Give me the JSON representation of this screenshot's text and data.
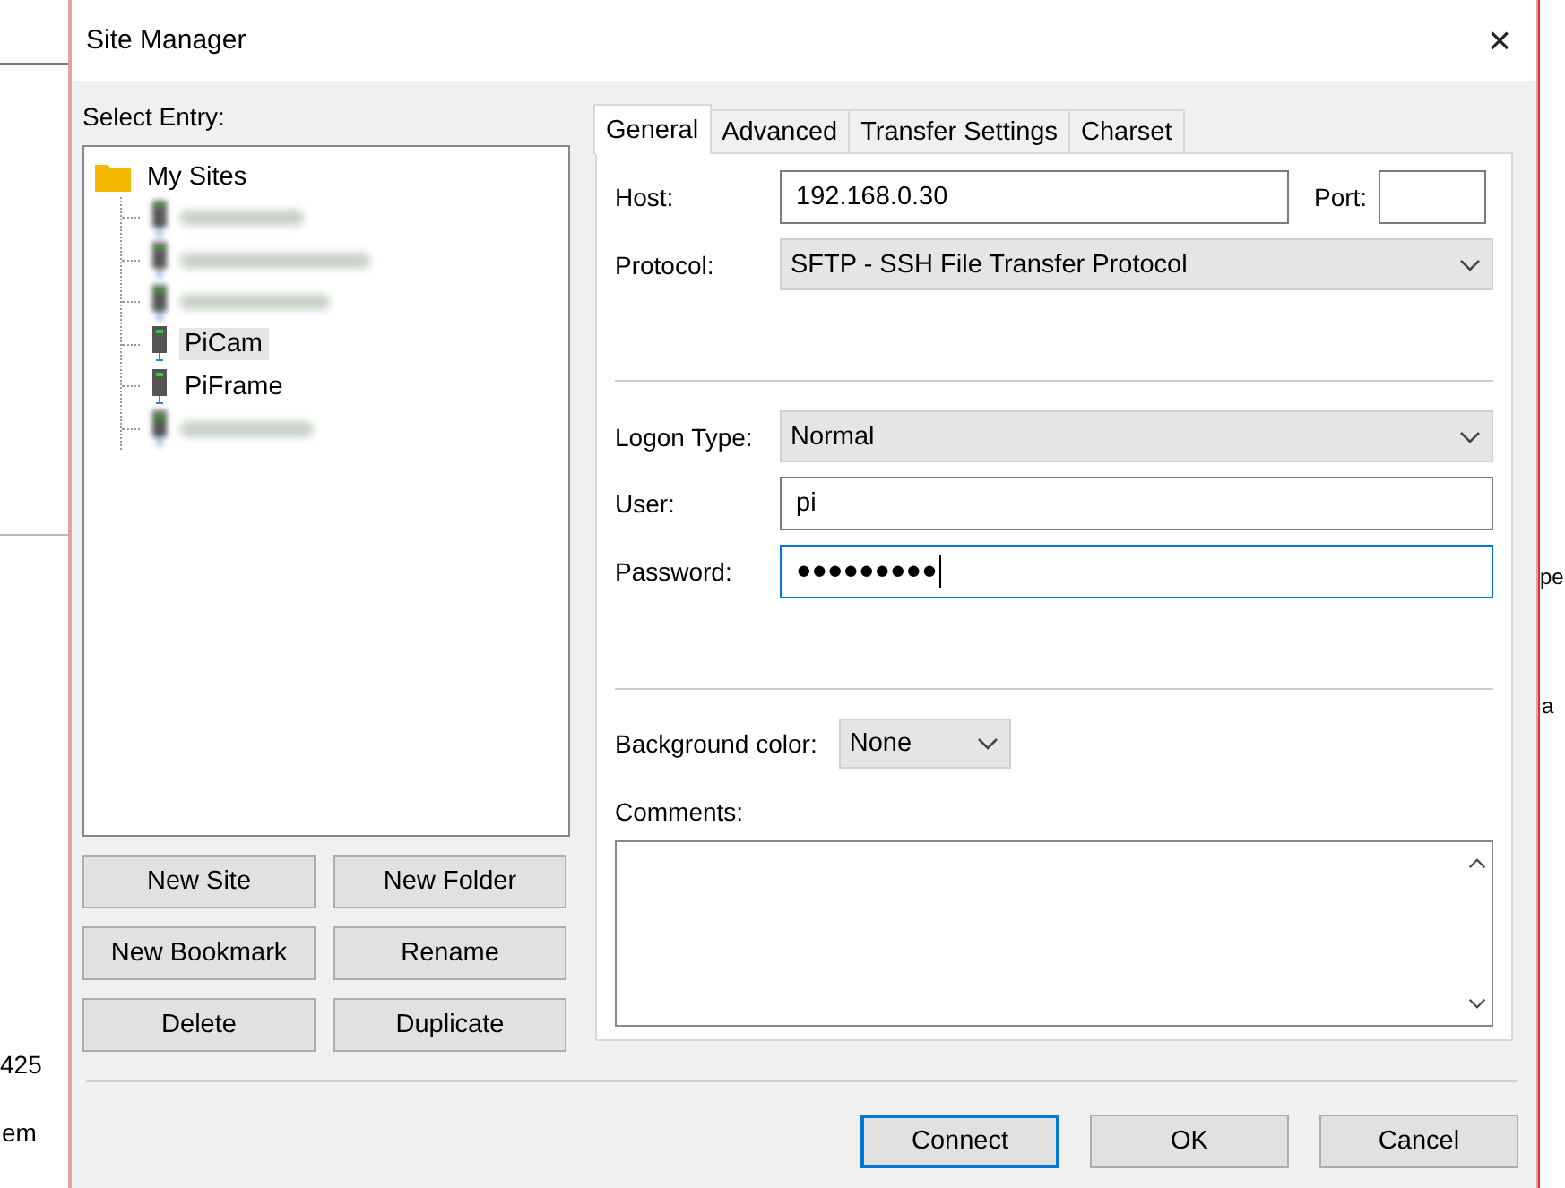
{
  "background_window": {
    "left_texts": [
      "425",
      "em"
    ],
    "right_texts": [
      "pe",
      "a"
    ]
  },
  "window": {
    "title": "Site Manager",
    "close": "×"
  },
  "select_entry_label": "Select Entry:",
  "tree": {
    "label": "My Sites",
    "expanded": true,
    "children": [
      {
        "kind": "blurred",
        "selected": false
      },
      {
        "kind": "blurred",
        "selected": false
      },
      {
        "kind": "blurred",
        "selected": false
      },
      {
        "kind": "site",
        "label": "PiCam",
        "selected": true
      },
      {
        "kind": "site",
        "label": "PiFrame",
        "selected": false
      },
      {
        "kind": "blurred",
        "selected": false
      }
    ]
  },
  "site_buttons": [
    "New Site",
    "New Folder",
    "New Bookmark",
    "Rename",
    "Delete",
    "Duplicate"
  ],
  "tabs": [
    {
      "label": "General",
      "selected": true
    },
    {
      "label": "Advanced",
      "selected": false
    },
    {
      "label": "Transfer Settings",
      "selected": false
    },
    {
      "label": "Charset",
      "selected": false
    }
  ],
  "general": {
    "host": {
      "label": "Host:",
      "value": "192.168.0.30"
    },
    "port": {
      "label": "Port:"
    },
    "protocol": {
      "label": "Protocol:",
      "value": "SFTP - SSH File Transfer Protocol"
    },
    "logon_type": {
      "label": "Logon Type:",
      "value": "Normal"
    },
    "user": {
      "label": "User:",
      "value": "pi",
      "focused": false
    },
    "password": {
      "label": "Password:",
      "value": "●●●●●●●●●",
      "focused": true
    },
    "background_color": {
      "label": "Background color:",
      "value": "None"
    },
    "comments": {
      "label": "Comments:"
    }
  },
  "dialog_buttons": [
    {
      "label": "Connect",
      "default": true
    },
    {
      "label": "OK",
      "default": false
    },
    {
      "label": "Cancel",
      "default": false
    }
  ]
}
